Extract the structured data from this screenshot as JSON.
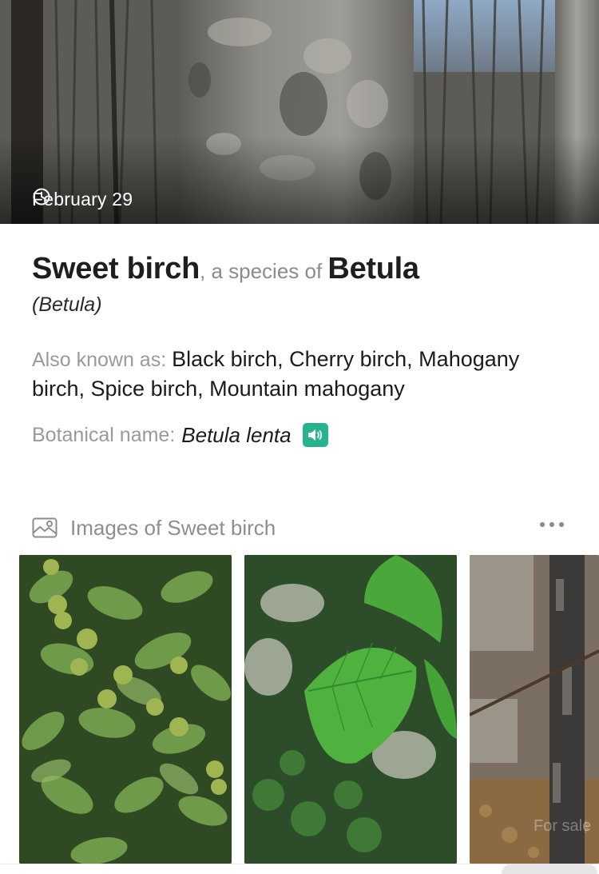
{
  "hero": {
    "date": "February 29",
    "icon": "clock-icon"
  },
  "species": {
    "common_name": "Sweet birch",
    "relation": ", a species of ",
    "genus": "Betula",
    "genus_paren": "(Betula)"
  },
  "also_known_as": {
    "label": "Also known as: ",
    "names": "Black birch, Cherry birch, Mahogany birch, Spice birch, Mountain mahogany"
  },
  "botanical": {
    "label": "Botanical name: ",
    "value": "Betula lenta",
    "audio_icon": "speaker-icon",
    "audio_color": "#27b38d"
  },
  "images": {
    "header_label": "Images of Sweet birch",
    "header_icon": "image-icon",
    "more_icon": "more-dots-icon",
    "thumbnails": [
      {
        "subject": "birch-leaves-with-catkins"
      },
      {
        "subject": "birch-leaf-closeup"
      },
      {
        "subject": "birch-trunk-bark"
      }
    ],
    "watermark": "For sale"
  }
}
